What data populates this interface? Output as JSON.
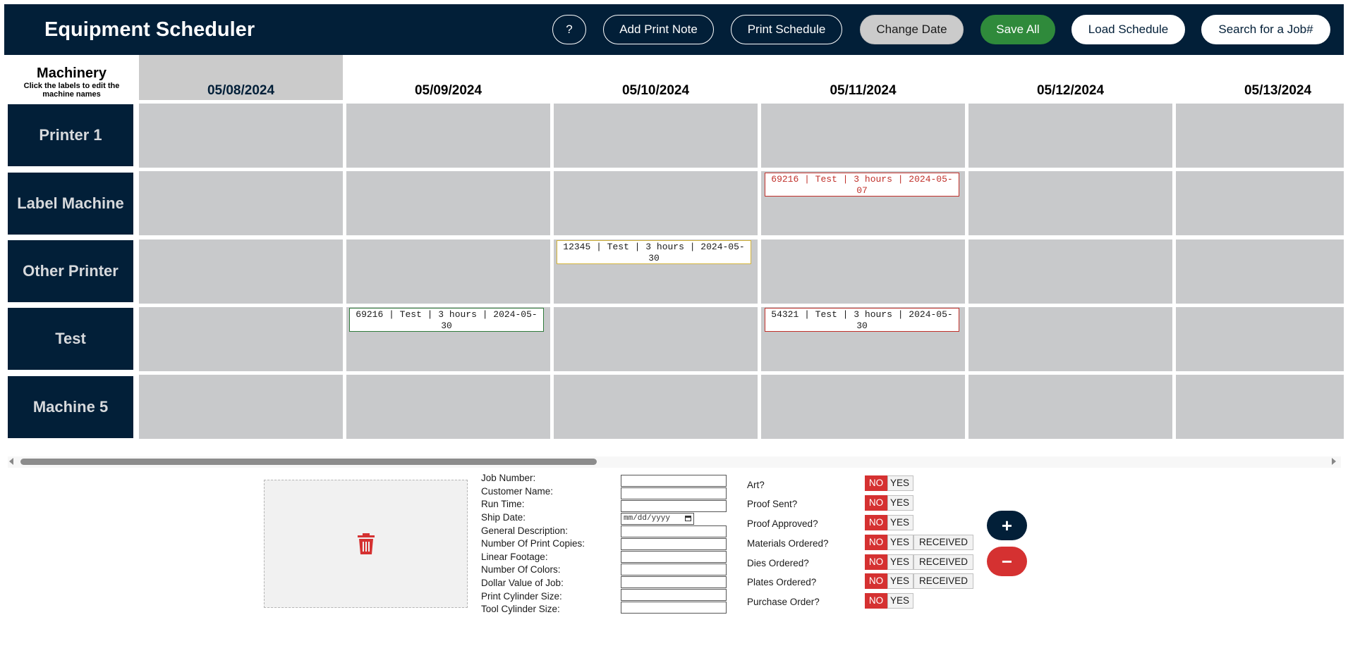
{
  "header": {
    "title": "Equipment Scheduler",
    "buttons": {
      "help": "?",
      "add_print_note": "Add Print Note",
      "print_schedule": "Print Schedule",
      "change_date": "Change Date",
      "save_all": "Save All",
      "load_schedule": "Load Schedule",
      "search_job": "Search for a Job#"
    }
  },
  "grid": {
    "machinery_label": "Machinery",
    "machinery_hint": "Click the labels to edit the machine names",
    "dates": [
      "05/08/2024",
      "05/09/2024",
      "05/10/2024",
      "05/11/2024",
      "05/12/2024",
      "05/13/2024"
    ],
    "machines": [
      "Printer 1",
      "Label Machine",
      "Other Printer",
      "Test",
      "Machine 5"
    ],
    "jobs": [
      {
        "machine": "Label Machine",
        "date": "05/11/2024",
        "text": "69216 | Test | 3 hours | 2024-05-07",
        "status": "red-text"
      },
      {
        "machine": "Other Printer",
        "date": "05/10/2024",
        "text": "12345 | Test | 3 hours | 2024-05-30",
        "status": "yellow"
      },
      {
        "machine": "Test",
        "date": "05/09/2024",
        "text": "69216 | Test | 3 hours | 2024-05-30",
        "status": "green"
      },
      {
        "machine": "Test",
        "date": "05/11/2024",
        "text": "54321 | Test | 3 hours | 2024-05-30",
        "status": "red"
      }
    ]
  },
  "form": {
    "fields": [
      {
        "label": "Job Number:",
        "value": ""
      },
      {
        "label": "Customer Name:",
        "value": ""
      },
      {
        "label": "Run Time:",
        "value": ""
      },
      {
        "label": "Ship Date:",
        "value": "",
        "placeholder": "mm/dd/yyyy"
      },
      {
        "label": "General Description:",
        "value": ""
      },
      {
        "label": "Number Of Print Copies:",
        "value": ""
      },
      {
        "label": "Linear Footage:",
        "value": ""
      },
      {
        "label": "Number Of Colors:",
        "value": ""
      },
      {
        "label": "Dollar Value of Job:",
        "value": ""
      },
      {
        "label": "Print Cylinder Size:",
        "value": ""
      },
      {
        "label": "Tool Cylinder Size:",
        "value": ""
      }
    ],
    "questions": [
      {
        "label": "Art?",
        "no": "NO",
        "yes": "YES",
        "selected": "NO"
      },
      {
        "label": "Proof Sent?",
        "no": "NO",
        "yes": "YES",
        "selected": "NO"
      },
      {
        "label": "Proof Approved?",
        "no": "NO",
        "yes": "YES",
        "selected": "NO"
      },
      {
        "label": "Materials Ordered?",
        "no": "NO",
        "yes": "YES",
        "received": "RECEIVED",
        "selected": "NO"
      },
      {
        "label": "Dies Ordered?",
        "no": "NO",
        "yes": "YES",
        "received": "RECEIVED",
        "selected": "NO"
      },
      {
        "label": "Plates Ordered?",
        "no": "NO",
        "yes": "YES",
        "received": "RECEIVED",
        "selected": "NO"
      },
      {
        "label": "Purchase Order?",
        "no": "NO",
        "yes": "YES",
        "selected": "NO"
      }
    ],
    "add_button": "+",
    "remove_button": "−"
  },
  "colors": {
    "navy": "#021f38",
    "cell_grey": "#c8c9cb",
    "no_red": "#d53131",
    "save_green": "#2f8a3b"
  }
}
